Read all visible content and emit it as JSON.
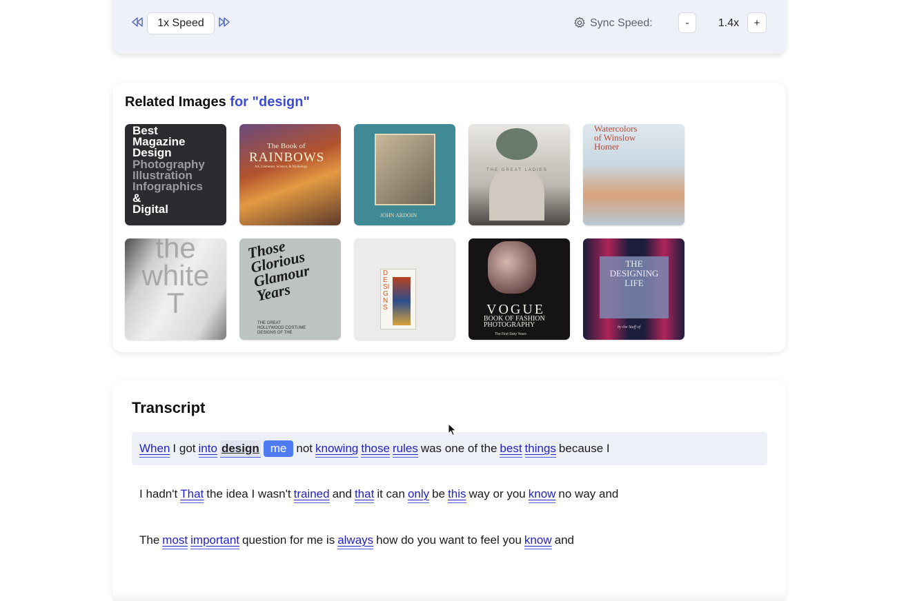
{
  "player": {
    "speed_label": "1x Speed",
    "rewind_icon": "rewind-icon",
    "forward_icon": "fast-forward-icon",
    "sync_label": "Sync Speed:",
    "minus_label": "-",
    "sync_value": "1.4x",
    "plus_label": "+"
  },
  "related": {
    "title": "Related Images",
    "query": "for \"design\"",
    "images": [
      {
        "name": "Best Magazine Design",
        "lines": [
          "Best",
          "Magazine",
          "Design",
          "Photography",
          "Illustration",
          "Infographics",
          "&",
          "Digital"
        ]
      },
      {
        "name": "The Book of Rainbows",
        "lines": [
          "The Book of",
          "RAINBOWS",
          "Art, Literature, Science, & Mythology"
        ]
      },
      {
        "name": "John Ardoin",
        "lines": [
          "JOHN ARDOIN"
        ]
      },
      {
        "name": "The Great Ladies",
        "lines": [
          "THE GREAT LADIES"
        ]
      },
      {
        "name": "Watercolors of Winslow Homer",
        "lines": [
          "Watercolors",
          "of Winslow",
          "Homer"
        ]
      },
      {
        "name": "the white T",
        "lines": [
          "the",
          "white",
          "T"
        ]
      },
      {
        "name": "Those Glorious Glamour Years",
        "lines": [
          "Those",
          "Glorious",
          "Glamour",
          "Years",
          "THE GREAT",
          "HOLLYWOOD COSTUME",
          "DESIGNS OF THE"
        ]
      },
      {
        "name": "Designs",
        "lines": [
          "DESIGNS"
        ]
      },
      {
        "name": "Vogue Book of Fashion Photography",
        "lines": [
          "VOGUE",
          "BOOK OF FASHION",
          "PHOTOGRAPHY",
          "The First Sixty Years"
        ]
      },
      {
        "name": "The Designing Life",
        "lines": [
          "THE",
          "DESIGNING",
          "LIFE",
          "by the Staff of"
        ]
      }
    ]
  },
  "transcript": {
    "title": "Transcript",
    "lines": [
      [
        {
          "t": "When",
          "s": "link"
        },
        {
          "t": "I got",
          "s": "plain"
        },
        {
          "t": "into",
          "s": "link"
        },
        {
          "t": "design",
          "s": "bold"
        },
        {
          "t": "me",
          "s": "pill"
        },
        {
          "t": "not",
          "s": "plain"
        },
        {
          "t": "knowing",
          "s": "link"
        },
        {
          "t": "those",
          "s": "link"
        },
        {
          "t": "rules",
          "s": "link"
        },
        {
          "t": "was one of the",
          "s": "plain"
        },
        {
          "t": "best",
          "s": "link"
        },
        {
          "t": "things",
          "s": "link"
        },
        {
          "t": "because I",
          "s": "plain"
        }
      ],
      [
        {
          "t": "I hadn't",
          "s": "plain"
        },
        {
          "t": "That",
          "s": "link"
        },
        {
          "t": "the idea I wasn't",
          "s": "plain"
        },
        {
          "t": "trained",
          "s": "link"
        },
        {
          "t": "and",
          "s": "plain"
        },
        {
          "t": "that",
          "s": "link"
        },
        {
          "t": "it can",
          "s": "plain"
        },
        {
          "t": "only",
          "s": "link"
        },
        {
          "t": "be",
          "s": "plain"
        },
        {
          "t": "this",
          "s": "link"
        },
        {
          "t": "way or you",
          "s": "plain"
        },
        {
          "t": "know",
          "s": "link"
        },
        {
          "t": "no way and",
          "s": "plain"
        }
      ],
      [
        {
          "t": "The",
          "s": "plain"
        },
        {
          "t": "most",
          "s": "link"
        },
        {
          "t": "important",
          "s": "link"
        },
        {
          "t": "question for me is",
          "s": "plain"
        },
        {
          "t": "always",
          "s": "link"
        },
        {
          "t": "how do you want to feel you",
          "s": "plain"
        },
        {
          "t": "know",
          "s": "link"
        },
        {
          "t": "and",
          "s": "plain"
        }
      ]
    ]
  },
  "colors": {
    "accent": "#3b4bd8",
    "link": "#1f1fc8",
    "pill": "#4f7cf2",
    "card_bg": "#eef2f8"
  }
}
